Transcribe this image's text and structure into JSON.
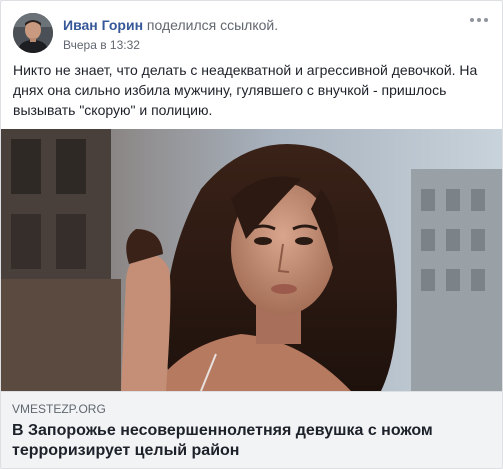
{
  "post": {
    "author": "Иван Горин",
    "action": "поделился ссылкой.",
    "timestamp": "Вчера в 13:32",
    "text": "Никто не знает, что делать с неадекватной и агрессивной девочкой. На днях она сильно избила мужчину, гулявшего с внучкой - пришлось вызывать \"скорую\" и полицию."
  },
  "link": {
    "domain": "VMESTEZP.ORG",
    "title": "В Запорожье несовершеннолетняя девушка с ножом терроризирует целый район"
  },
  "icons": {
    "more": "more-options-icon",
    "avatar": "avatar-photo"
  },
  "colors": {
    "author_link": "#365899",
    "secondary_text": "#616770",
    "caption_background": "#f2f3f5"
  }
}
